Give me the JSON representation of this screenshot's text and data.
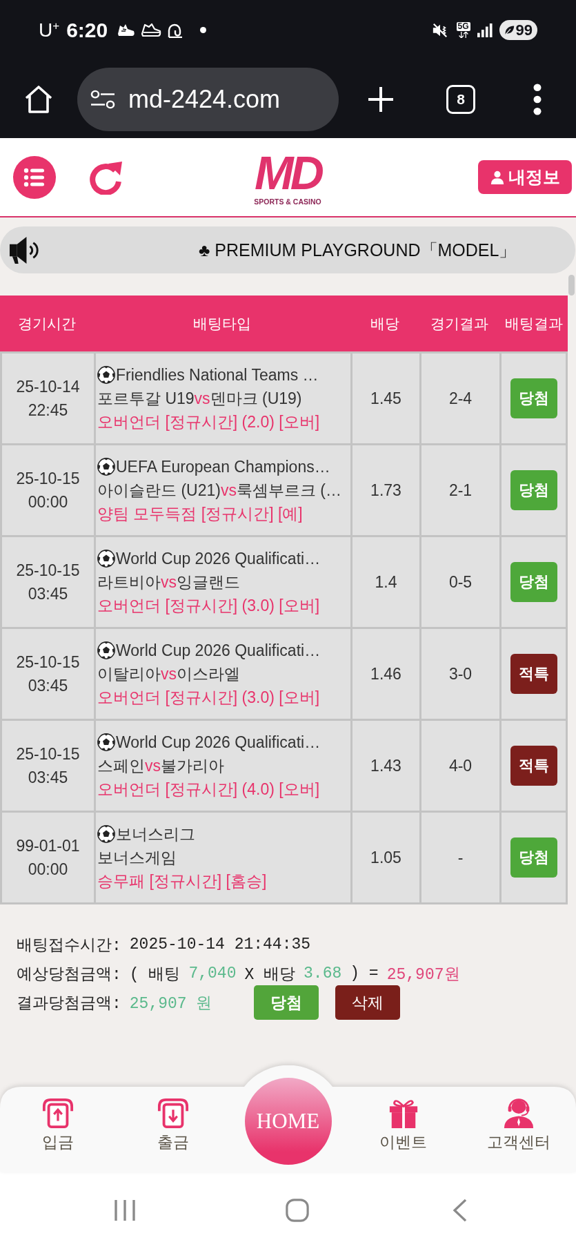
{
  "status_bar": {
    "carrier": "U$^{+}$",
    "time": "6:20",
    "network": "5G",
    "battery": "99"
  },
  "browser": {
    "url": "md-2424.com",
    "tab_count": "8"
  },
  "header": {
    "logo": "MD",
    "tagline": "SPORTS & CASINO",
    "account_button": "내정보"
  },
  "notice": {
    "text": "♣ PREMIUM PLAYGROUND「MODEL」"
  },
  "bet_table": {
    "columns": [
      "경기시간",
      "배팅타입",
      "배당",
      "경기결과",
      "배팅결과"
    ],
    "rows": [
      {
        "date": "25-10-14",
        "time": "22:45",
        "league": "Friendlies National Teams …",
        "matchup": [
          {
            "kind": "team",
            "text": "포르투갈 U19"
          },
          {
            "kind": "vs",
            "text": "vs"
          },
          {
            "kind": "team",
            "text": "덴마크 (U19)"
          }
        ],
        "market": "오버언더 [정규시간] (2.0) [오버]",
        "odds": "1.45",
        "score": "2-4",
        "result": "당첨",
        "color": "#4ea83a"
      },
      {
        "date": "25-10-15",
        "time": "00:00",
        "league": "UEFA European Champions…",
        "matchup": [
          {
            "kind": "team",
            "text": "아이슬란드 (U21)"
          },
          {
            "kind": "vs",
            "text": "vs"
          },
          {
            "kind": "team",
            "text": "룩셈부르크 (…"
          }
        ],
        "market": "양팀 모두득점 [정규시간] [예]",
        "odds": "1.73",
        "score": "2-1",
        "result": "당첨",
        "color": "#4ea83a"
      },
      {
        "date": "25-10-15",
        "time": "03:45",
        "league": "World Cup 2026 Qualificati…",
        "matchup": [
          {
            "kind": "team",
            "text": "라트비아"
          },
          {
            "kind": "vs",
            "text": "vs"
          },
          {
            "kind": "team",
            "text": "잉글랜드"
          }
        ],
        "market": "오버언더 [정규시간] (3.0) [오버]",
        "odds": "1.4",
        "score": "0-5",
        "result": "당첨",
        "color": "#4ea83a"
      },
      {
        "date": "25-10-15",
        "time": "03:45",
        "league": "World Cup 2026 Qualificati…",
        "matchup": [
          {
            "kind": "team",
            "text": "이탈리아"
          },
          {
            "kind": "vs",
            "text": "vs"
          },
          {
            "kind": "team",
            "text": "이스라엘"
          }
        ],
        "market": "오버언더 [정규시간] (3.0) [오버]",
        "odds": "1.46",
        "score": "3-0",
        "result": "적특",
        "color": "#7c1f1c"
      },
      {
        "date": "25-10-15",
        "time": "03:45",
        "league": "World Cup 2026 Qualificati…",
        "matchup": [
          {
            "kind": "team",
            "text": "스페인"
          },
          {
            "kind": "vs",
            "text": "vs"
          },
          {
            "kind": "team",
            "text": "불가리아"
          }
        ],
        "market": "오버언더 [정규시간] (4.0) [오버]",
        "odds": "1.43",
        "score": "4-0",
        "result": "적특",
        "color": "#7c1f1c"
      },
      {
        "date": "99-01-01",
        "time": "00:00",
        "league": "보너스리그",
        "matchup": [
          {
            "kind": "team",
            "text": "보너스게임"
          }
        ],
        "market": "승무패 [정규시간] [홈승]",
        "odds": "1.05",
        "score": "-",
        "result": "당첨",
        "color": "#4ea83a"
      }
    ]
  },
  "summary": {
    "bet_time_label": "배팅접수시간:",
    "bet_time": "2025-10-14 21:44:35",
    "expected_label": "예상당첨금액:",
    "formula_open": "( 배팅",
    "stake": "7,040",
    "formula_times": "X 배당",
    "odds": "3.68",
    "formula_close": ") =",
    "expected_amount": "25,907원",
    "result_label": "결과당첨금액:",
    "result_amount": "25,907 원",
    "buttons": [
      {
        "kind": "status",
        "label": "당첨"
      },
      {
        "kind": "delete",
        "label": "삭제"
      }
    ]
  },
  "bottom_nav": {
    "items": [
      {
        "kind": "deposit",
        "label": "입금"
      },
      {
        "kind": "withdraw",
        "label": "출금"
      },
      {
        "kind": "home",
        "label": "HOME"
      },
      {
        "kind": "event",
        "label": "이벤트"
      },
      {
        "kind": "support",
        "label": "고객센터"
      }
    ]
  }
}
